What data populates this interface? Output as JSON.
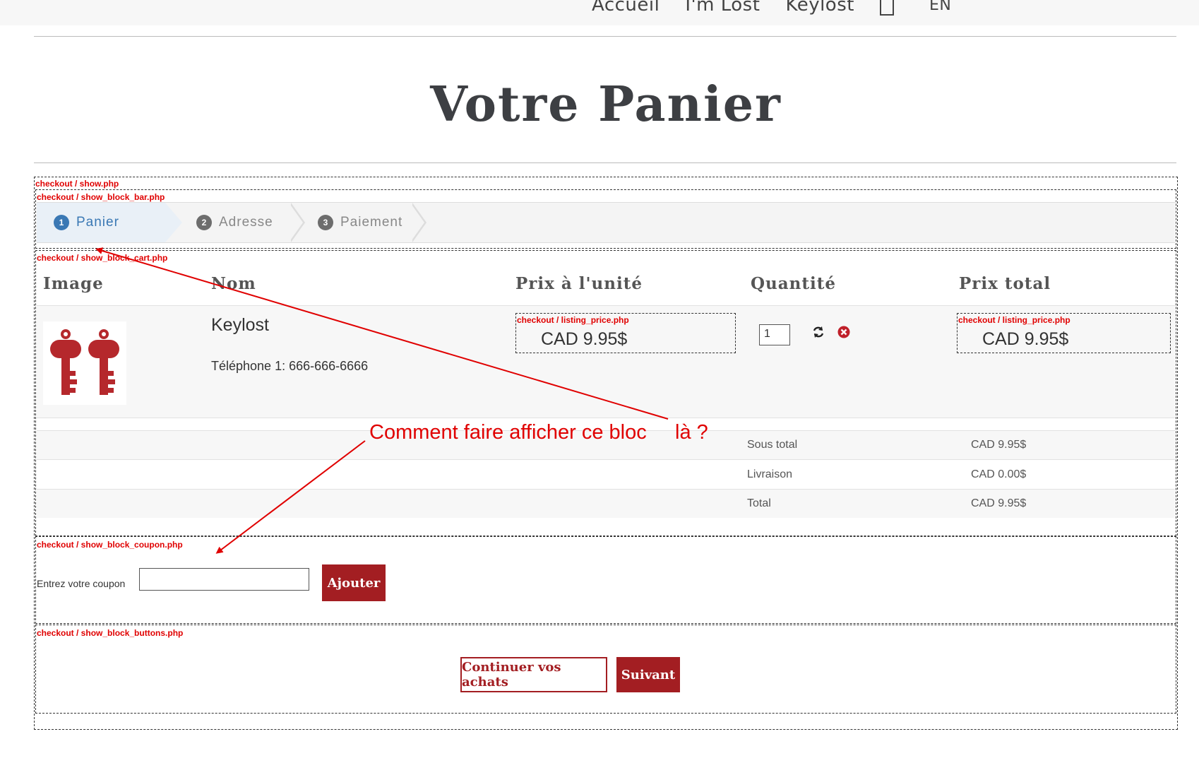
{
  "nav": {
    "items": [
      "Accueil",
      "I'm Lost",
      "Keylost"
    ],
    "lang": "EN"
  },
  "page": {
    "title": "Votre Panier"
  },
  "debug": {
    "show": "checkout / show.php",
    "bar": "checkout / show_block_bar.php",
    "cart": "checkout / show_block_cart.php",
    "listing_price_unit": "checkout / listing_price.php",
    "listing_price_total": "checkout / listing_price.php",
    "coupon": "checkout / show_block_coupon.php",
    "buttons": "checkout / show_block_buttons.php"
  },
  "steps": [
    {
      "num": "1",
      "label": "Panier"
    },
    {
      "num": "2",
      "label": "Adresse"
    },
    {
      "num": "3",
      "label": "Paiement"
    }
  ],
  "table": {
    "headers": [
      "Image",
      "Nom",
      "Prix à l'unité",
      "Quantité",
      "Prix total"
    ],
    "item": {
      "name": "Keylost",
      "detail": "Téléphone 1: 666-666-6666",
      "unit_price": "CAD 9.95$",
      "quantity": "1",
      "total_price": "CAD 9.95$",
      "refresh_icon": "refresh-icon",
      "remove_icon": "remove-icon"
    }
  },
  "summary": [
    {
      "label": "Sous total",
      "value": "CAD 9.95$"
    },
    {
      "label": "Livraison",
      "value": "CAD 0.00$"
    },
    {
      "label": "Total",
      "value": "CAD 9.95$"
    }
  ],
  "coupon": {
    "label": "Entrez votre coupon",
    "button": "Ajouter"
  },
  "buttons": {
    "continue": "Continuer vos achats",
    "next": "Suivant"
  },
  "annotation": {
    "text": "Comment faire afficher ce bloc     là ?"
  },
  "colors": {
    "accent": "#a31e22",
    "step_active": "#3a78b4",
    "annotation": "#e00000"
  }
}
